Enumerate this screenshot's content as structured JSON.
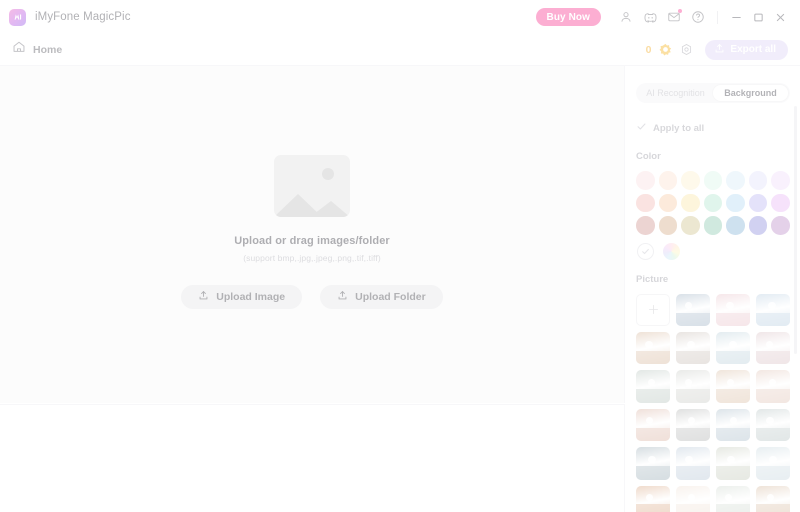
{
  "titlebar": {
    "app_title": "iMyFone MagicPic",
    "logo_icon": "magicpic-logo-icon",
    "buy_now_label": "Buy Now",
    "icons": [
      {
        "name": "account-icon",
        "glyph": "person"
      },
      {
        "name": "discord-icon",
        "glyph": "discord"
      },
      {
        "name": "mail-icon",
        "glyph": "mail",
        "badge": true
      },
      {
        "name": "help-icon",
        "glyph": "question-circle"
      }
    ],
    "window_controls": [
      {
        "name": "minimize-button",
        "glyph": "minimize"
      },
      {
        "name": "maximize-button",
        "glyph": "maximize"
      },
      {
        "name": "close-button",
        "glyph": "close"
      }
    ]
  },
  "subheader": {
    "home_label": "Home",
    "home_icon": "home-icon",
    "credit_count": "0",
    "coin_icon": "coin-icon",
    "settings_icon": "settings-hex-icon",
    "export_label": "Export all",
    "export_icon": "export-icon"
  },
  "canvas": {
    "placeholder_icon": "image-placeholder-icon",
    "drop_title": "Upload or drag images/folder",
    "drop_subtitle": "(support bmp,.jpg,.jpeg,.png,.tif,.tiff)",
    "upload_image_label": "Upload Image",
    "upload_folder_label": "Upload Folder",
    "upload_icon": "upload-icon"
  },
  "panel": {
    "tabs": [
      {
        "label": "AI Recognition",
        "active": false
      },
      {
        "label": "Background",
        "active": true
      }
    ],
    "apply_to_all_label": "Apply to all",
    "apply_to_all_icon": "check-icon",
    "color_section_label": "Color",
    "colors": [
      "#fbdfe0",
      "#fce0cf",
      "#fcefcd",
      "#d9f4e9",
      "#d8ecf8",
      "#e2e0fa",
      "#f0dcfb",
      "#f3b8b4",
      "#f8cba5",
      "#fae6a8",
      "#b2e6cf",
      "#b5daf2",
      "#bcb7f2",
      "#e8b6f5",
      "#cf9590",
      "#d4ab85",
      "#cfc38d",
      "#89c9ae",
      "#86b4d6",
      "#8d8ddc",
      "#bc8cc9"
    ],
    "selected_swatch_icon": "check-icon",
    "custom_color_icon": "color-wheel-icon",
    "picture_section_label": "Picture",
    "add_picture_icon": "plus-icon",
    "pictures": [
      "#9fb2c4",
      "#e8c2c9",
      "#b7cde0",
      "#d6b69b",
      "#c7bcb4",
      "#b9cfd9",
      "#d9c0c4",
      "#b7c4bd",
      "#c9cbc6",
      "#d9bda4",
      "#e0c3b6",
      "#d9b2a2",
      "#b0b2b1",
      "#a9bcc9",
      "#b6c3c3",
      "#9aacb6",
      "#b6c6d6",
      "#c2c8b8",
      "#c5d6dd",
      "#d8a480",
      "#efe0d4",
      "#cfd8cf",
      "#d5b89d"
    ]
  }
}
